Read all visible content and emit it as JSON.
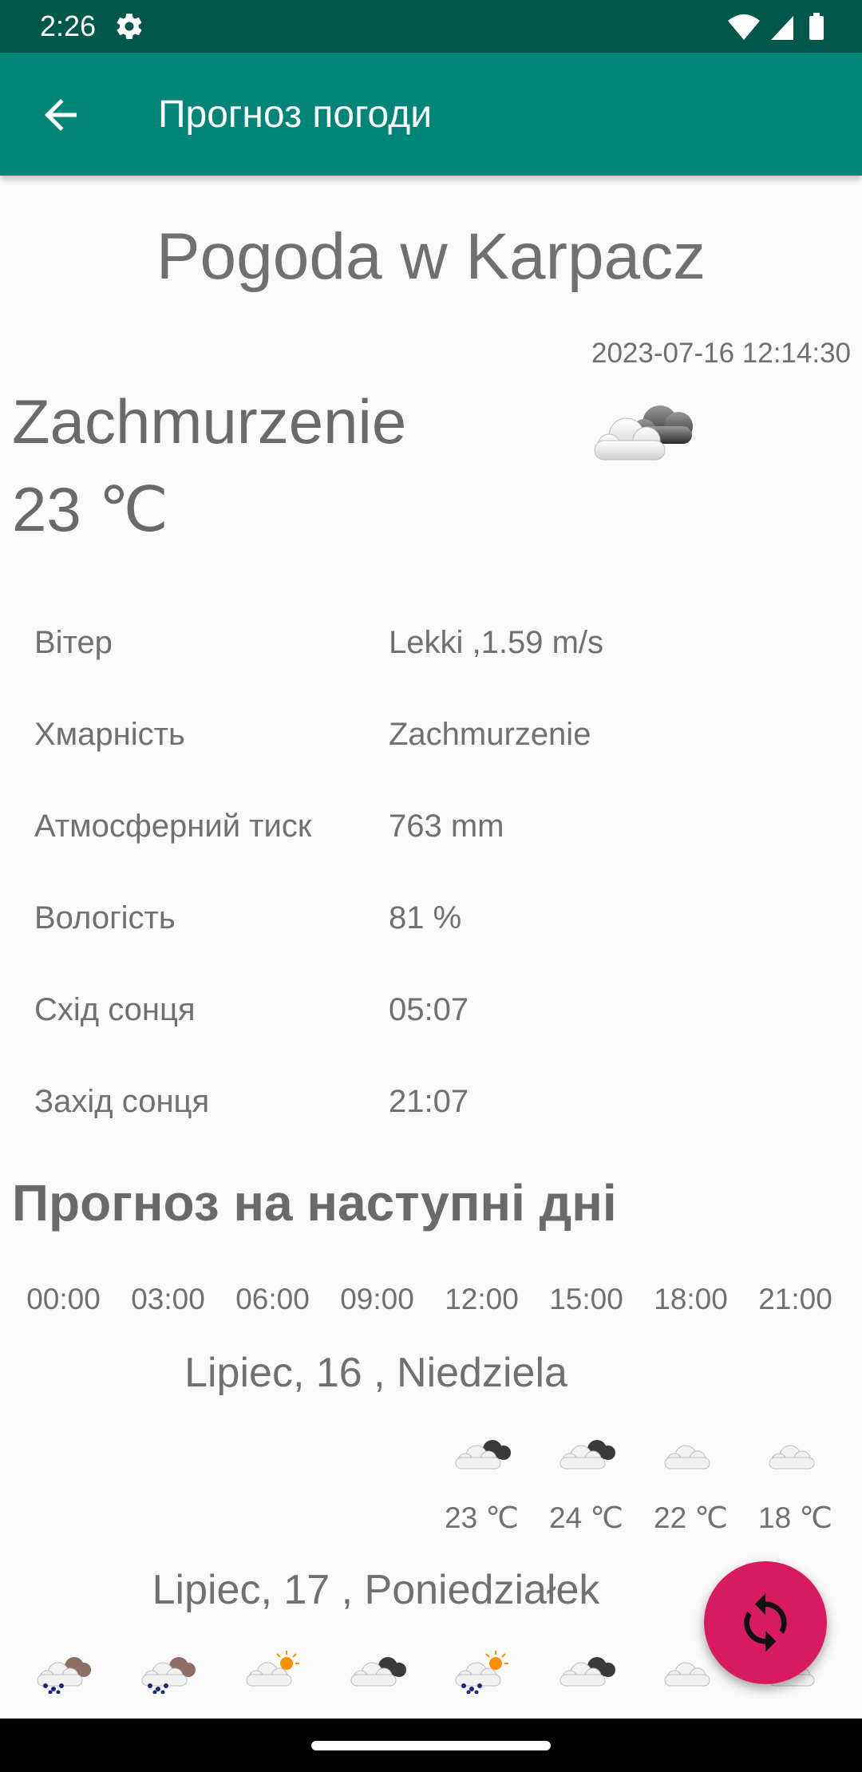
{
  "status_bar": {
    "time": "2:26"
  },
  "app_bar": {
    "title": "Прогноз погоди"
  },
  "city": {
    "title": "Pogoda w Karpacz"
  },
  "current": {
    "timestamp": "2023-07-16 12:14:30",
    "condition": "Zachmurzenie",
    "temperature": "23 ℃",
    "icon": "cloud-mostly-icon"
  },
  "details": [
    {
      "label": "Вітер",
      "value": "Lekki ,1.59 m/s"
    },
    {
      "label": "Хмарність",
      "value": "Zachmurzenie"
    },
    {
      "label": "Атмосферний тиск",
      "value": "763 mm"
    },
    {
      "label": "Вологість",
      "value": "81 %"
    },
    {
      "label": "Схід сонця",
      "value": "05:07"
    },
    {
      "label": "Захід сонця",
      "value": "21:07"
    }
  ],
  "forecast": {
    "heading": "Прогноз на наступні дні",
    "hours": [
      "00:00",
      "03:00",
      "06:00",
      "09:00",
      "12:00",
      "15:00",
      "18:00",
      "21:00"
    ],
    "days": [
      {
        "title": "Lipiec, 16 , Niedziela",
        "slots": [
          {
            "hour_index": 4,
            "icon": "cloud-dark-icon",
            "temp": "23 ℃"
          },
          {
            "hour_index": 5,
            "icon": "cloud-dark-icon",
            "temp": "24 ℃"
          },
          {
            "hour_index": 6,
            "icon": "cloud-light-icon",
            "temp": "22 ℃"
          },
          {
            "hour_index": 7,
            "icon": "cloud-light-icon",
            "temp": "18 ℃"
          }
        ]
      },
      {
        "title": "Lipiec, 17 , Poniedziałek",
        "slots": [
          {
            "hour_index": 0,
            "icon": "rain-cloud-icon"
          },
          {
            "hour_index": 1,
            "icon": "rain-cloud-icon"
          },
          {
            "hour_index": 2,
            "icon": "sun-cloud-icon"
          },
          {
            "hour_index": 3,
            "icon": "cloud-dark-icon"
          },
          {
            "hour_index": 4,
            "icon": "sun-rain-icon"
          },
          {
            "hour_index": 5,
            "icon": "cloud-dark-icon"
          },
          {
            "hour_index": 6,
            "icon": "cloud-light-icon"
          },
          {
            "hour_index": 7,
            "icon": "cloud-light-icon"
          }
        ]
      }
    ]
  },
  "colors": {
    "status_bar": "#00574b",
    "app_bar": "#008577",
    "fab": "#d81b60",
    "text": "#707070"
  }
}
